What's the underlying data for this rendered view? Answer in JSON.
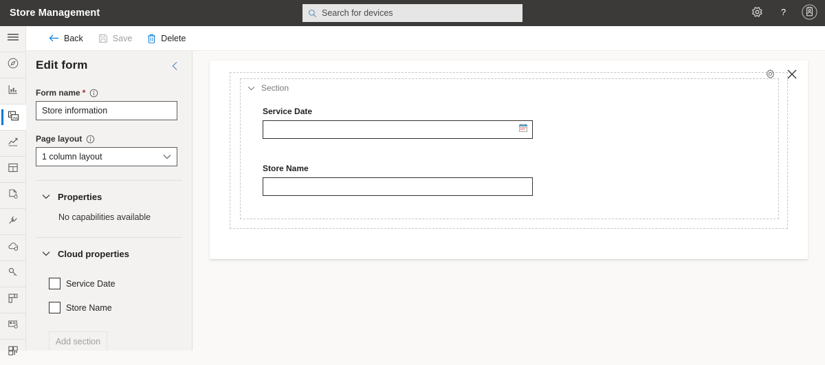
{
  "header": {
    "brand_title": "Store Management",
    "search": {
      "placeholder": "Search for devices",
      "value": "",
      "icon": "search-icon"
    },
    "actions": [
      {
        "name": "settings-icon",
        "label": "Settings"
      },
      {
        "name": "help-icon",
        "label": "Help"
      },
      {
        "name": "account-badge-icon",
        "label": "Account"
      }
    ],
    "background": "#3b3a39"
  },
  "left_rail": {
    "menu_icon": "hamburger-menu-icon",
    "selected_index": 2,
    "accent_color": "#0078d4",
    "items": [
      {
        "name": "rail-item-dashboard",
        "icon": "compass-icon"
      },
      {
        "name": "rail-item-reports",
        "icon": "bar-chart-icon"
      },
      {
        "name": "rail-item-devices",
        "icon": "devices-stack-icon"
      },
      {
        "name": "rail-item-analytics",
        "icon": "line-chart-icon"
      },
      {
        "name": "rail-item-layouts",
        "icon": "layout-grid-icon"
      },
      {
        "name": "rail-item-documents",
        "icon": "document-settings-icon"
      },
      {
        "name": "rail-item-automation",
        "icon": "flow-icon"
      },
      {
        "name": "rail-item-cloud",
        "icon": "cloud-settings-icon"
      },
      {
        "name": "rail-item-keys",
        "icon": "key-icon"
      },
      {
        "name": "rail-item-templates",
        "icon": "template-blocks-icon"
      },
      {
        "name": "rail-item-monitor",
        "icon": "monitor-settings-icon"
      },
      {
        "name": "rail-item-tiles",
        "icon": "tiles-grid-icon"
      }
    ]
  },
  "toolbar": {
    "back_label": "Back",
    "save_label": "Save",
    "delete_label": "Delete",
    "save_disabled": true
  },
  "panel": {
    "title": "Edit form",
    "collapse_icon": "chevron-left-icon",
    "form_name": {
      "label": "Form name",
      "required_marker": "*",
      "info_icon": "info-icon",
      "value": "Store information"
    },
    "page_layout": {
      "label": "Page layout",
      "info_icon": "info-icon",
      "selected": "1 column layout",
      "options": [
        "1 column layout"
      ]
    },
    "properties": {
      "title": "Properties",
      "expanded": true,
      "empty_text": "No capabilities available"
    },
    "cloud_properties": {
      "title": "Cloud properties",
      "expanded": true,
      "checkboxes": [
        {
          "label": "Service Date",
          "checked": false
        },
        {
          "label": "Store Name",
          "checked": false
        }
      ]
    },
    "add_section_label": "Add section",
    "add_section_disabled": true
  },
  "canvas": {
    "section": {
      "title": "Section",
      "expanded": true,
      "settings_icon": "gear-icon",
      "remove_icon": "close-icon"
    },
    "fields": [
      {
        "label": "Service Date",
        "value": "",
        "type": "date",
        "trailing_icon": "calendar-icon",
        "settings_icon": "gear-icon",
        "remove_icon": "close-icon"
      },
      {
        "label": "Store Name",
        "value": "",
        "type": "text",
        "trailing_icon": "",
        "settings_icon": "gear-icon",
        "remove_icon": "close-icon"
      }
    ]
  },
  "colors": {
    "header_bg": "#3b3a39",
    "accent": "#0078d4",
    "panel_bg": "#f3f2f1",
    "canvas_bg": "#faf9f8",
    "required_red": "#a4262c",
    "disabled_text": "#a19f9d"
  }
}
